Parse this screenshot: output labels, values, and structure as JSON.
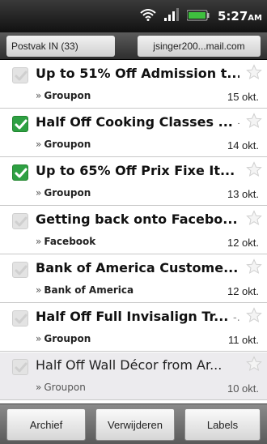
{
  "status_bar": {
    "time": "5:27",
    "ampm": "AM",
    "icons": [
      "wifi-icon",
      "signal-icon",
      "battery-icon"
    ],
    "battery_color": "#3fbf3f"
  },
  "header": {
    "folder_label": "Postvak IN (33)",
    "account_label": "jsinger200...mail.com"
  },
  "emails": [
    {
      "subject": "Up to 51% Off Admission t...",
      "extra": "",
      "sender": "Groupon",
      "date": "15 okt.",
      "checked": false,
      "read": false
    },
    {
      "subject": "Half Off Cooking Classes ...",
      "extra": "-...",
      "sender": "Groupon",
      "date": "14 okt.",
      "checked": true,
      "read": false
    },
    {
      "subject": "Up to 65% Off Prix Fixe It...",
      "extra": "-...",
      "sender": "Groupon",
      "date": "13 okt.",
      "checked": true,
      "read": false
    },
    {
      "subject": "Getting back onto Facebo...",
      "extra": "",
      "sender": "Facebook",
      "date": "12 okt.",
      "checked": false,
      "read": false
    },
    {
      "subject": "Bank of America Custome...",
      "extra": "",
      "sender": "Bank of America",
      "date": "12 okt.",
      "checked": false,
      "read": false
    },
    {
      "subject": "Half Off Full Invisalign Tr...",
      "extra": "-...",
      "sender": "Groupon",
      "date": "11 okt.",
      "checked": false,
      "read": false
    },
    {
      "subject": "Half Off Wall Décor from Ar...",
      "extra": "",
      "sender": "Groupon",
      "date": "10 okt.",
      "checked": false,
      "read": true
    }
  ],
  "sender_marker": "»",
  "toolbar": {
    "archive_label": "Archief",
    "delete_label": "Verwijderen",
    "labels_label": "Labels"
  },
  "colors": {
    "checked_green": "#2ea043",
    "read_row_bg": "#ecebee"
  }
}
